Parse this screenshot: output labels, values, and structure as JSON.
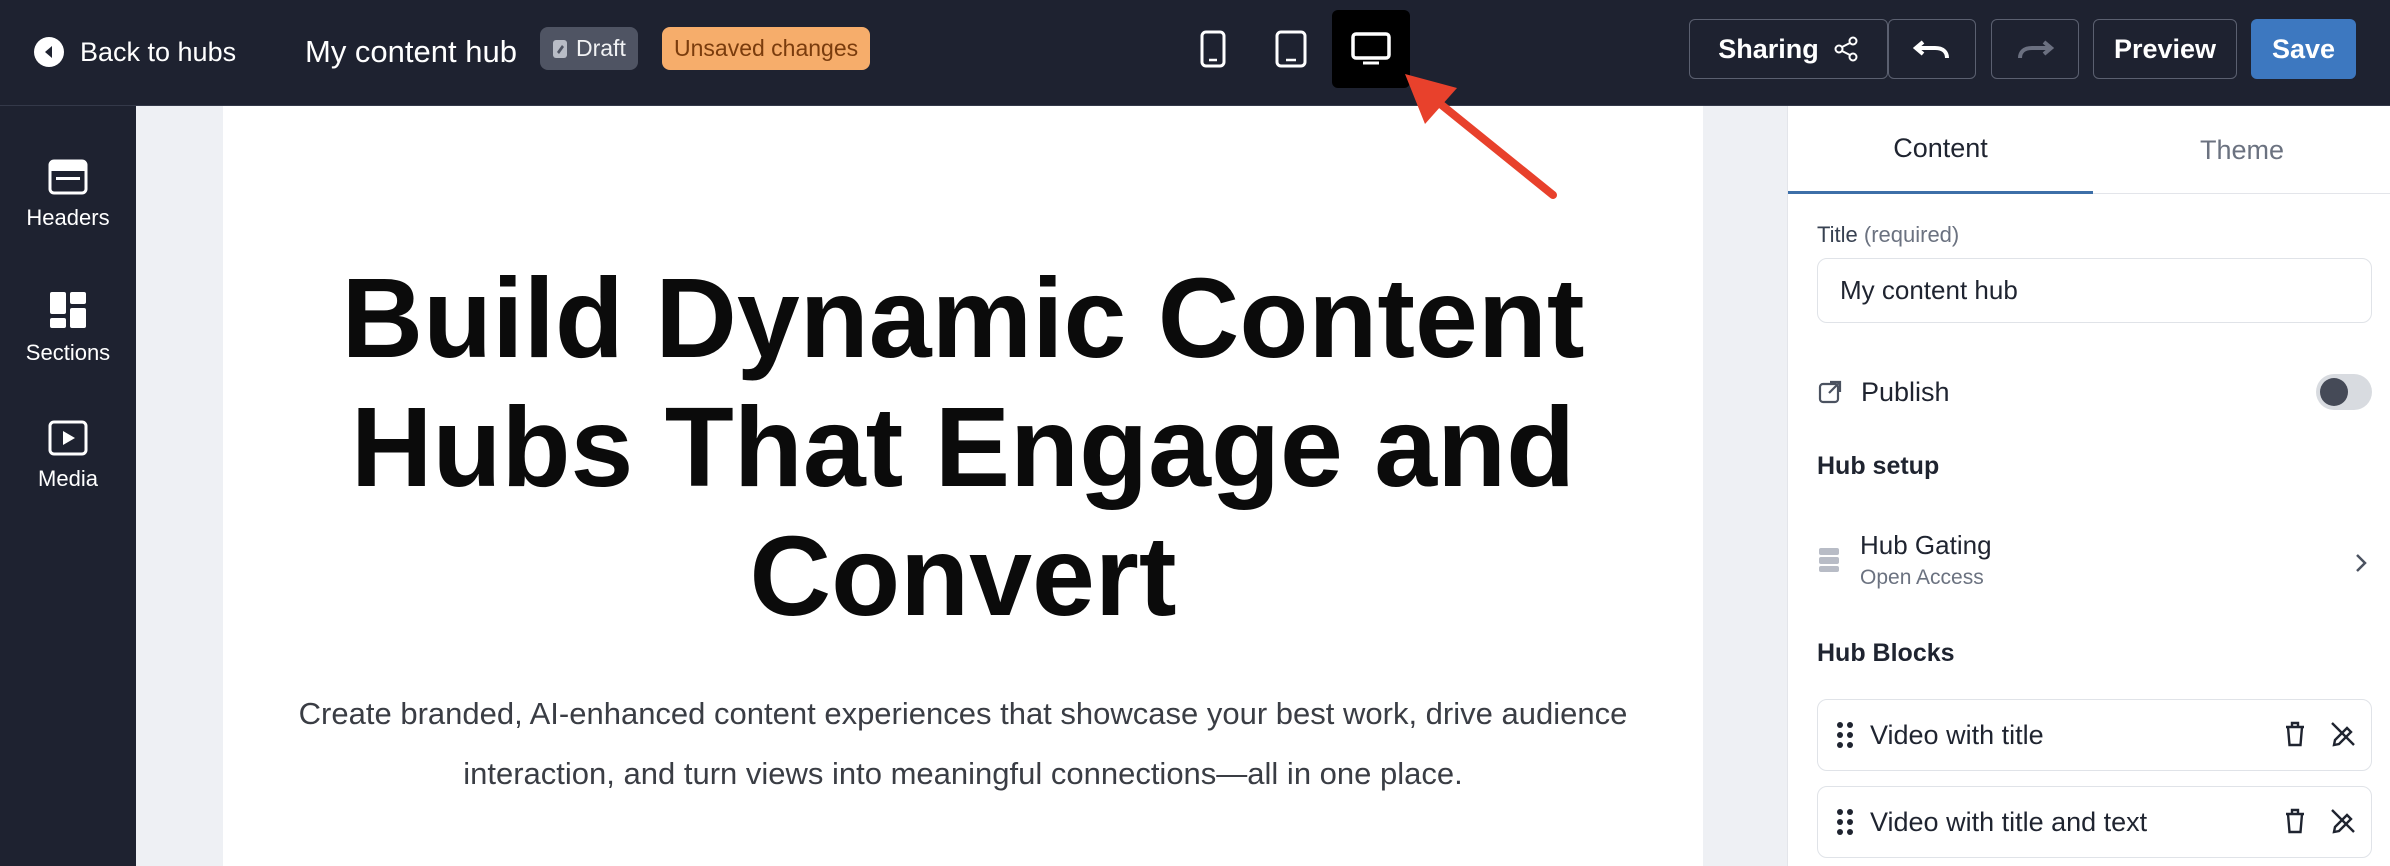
{
  "header": {
    "back_label": "Back to hubs",
    "hub_title": "My content hub",
    "draft_badge": "Draft",
    "unsaved_badge": "Unsaved changes",
    "sharing_label": "Sharing",
    "preview_label": "Preview",
    "save_label": "Save",
    "device_icons": [
      "mobile-icon",
      "tablet-icon",
      "desktop-icon"
    ],
    "active_device": "desktop"
  },
  "rail": {
    "items": [
      {
        "label": "Headers",
        "icon": "headers-icon"
      },
      {
        "label": "Sections",
        "icon": "sections-icon"
      },
      {
        "label": "Media",
        "icon": "media-icon"
      }
    ]
  },
  "canvas": {
    "headline": "Build Dynamic Content Hubs That Engage and Convert",
    "subhead": "Create branded, AI-enhanced content experiences that showcase your best work, drive audience interaction, and turn views into meaningful connections—all in one place."
  },
  "panel": {
    "tabs": [
      {
        "label": "Content",
        "active": true
      },
      {
        "label": "Theme",
        "active": false
      }
    ],
    "title_label": "Title",
    "title_required": "(required)",
    "title_value": "My content hub",
    "publish_label": "Publish",
    "publish_on": false,
    "hub_setup_title": "Hub setup",
    "gating_name": "Hub Gating",
    "gating_value": "Open Access",
    "hub_blocks_title": "Hub Blocks",
    "blocks": [
      {
        "label": "Video with title"
      },
      {
        "label": "Video with title and text"
      }
    ]
  },
  "colors": {
    "topbar": "#1e2230",
    "save": "#3d78c0",
    "unsaved_badge": "#f6ad6b",
    "annotation_arrow": "#e8412c"
  }
}
